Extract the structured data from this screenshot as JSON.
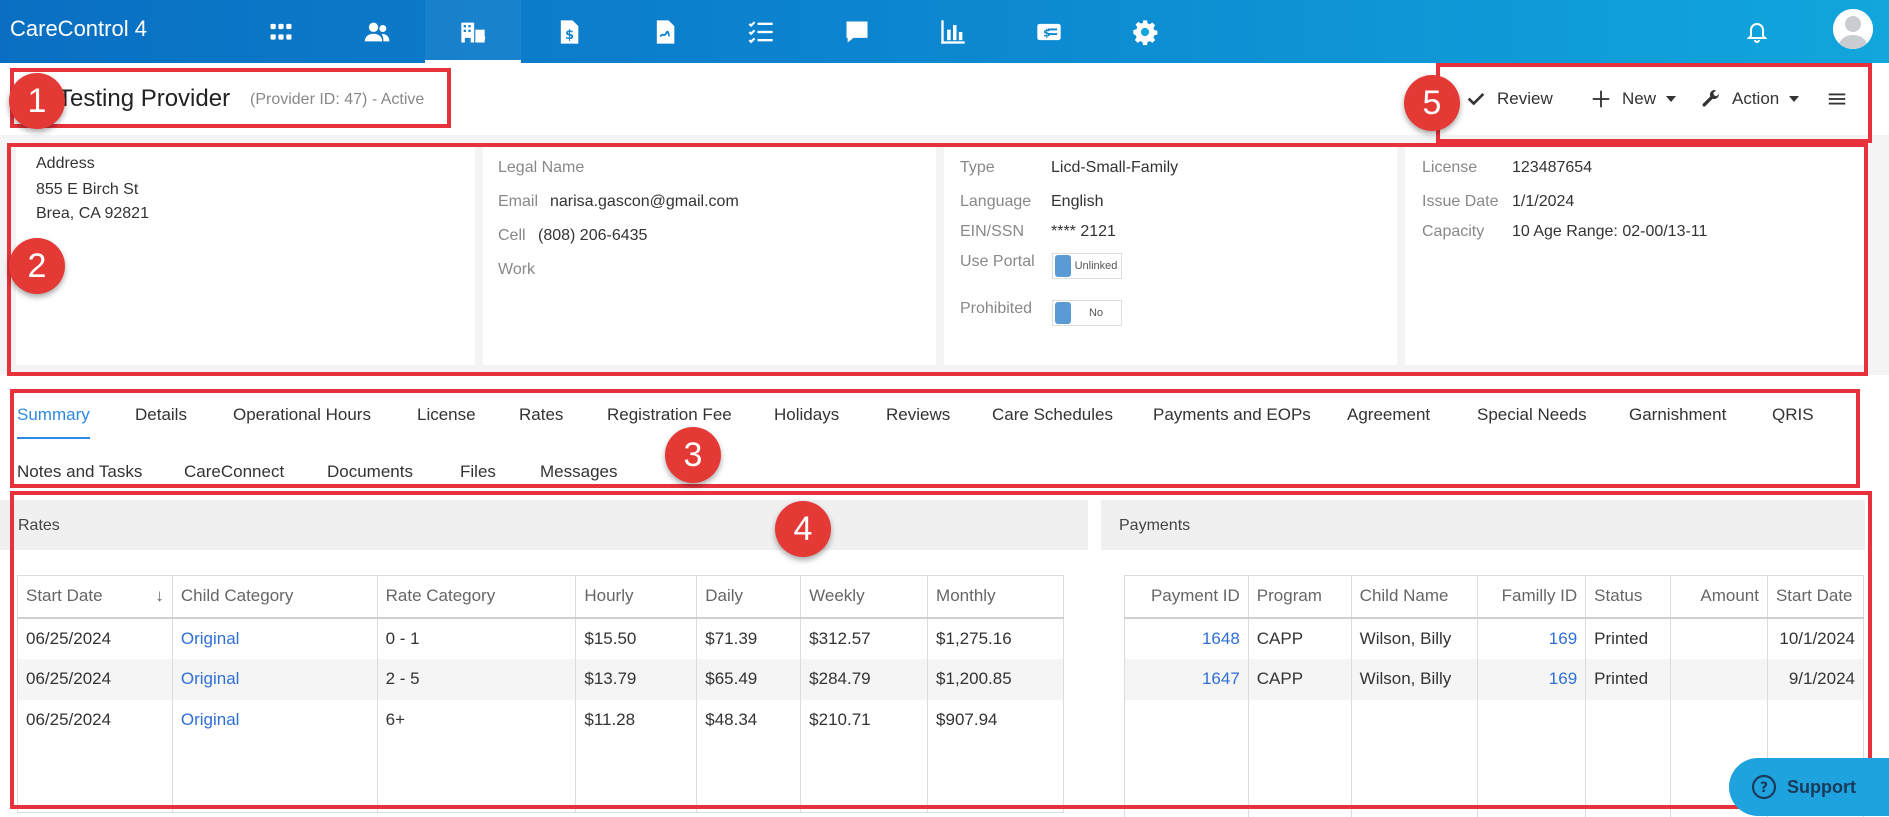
{
  "app": {
    "title": "CareControl 4"
  },
  "nav": {
    "icons": [
      "apps-grid-icon",
      "people-icon",
      "providers-building-icon",
      "billing-dollar-icon",
      "report-file-icon",
      "checklist-icon",
      "chat-bubble-icon",
      "bar-chart-icon",
      "payment-card-icon",
      "gear-icon"
    ],
    "active": "providers-building-icon"
  },
  "header": {
    "provider_name": "Testing Provider",
    "provider_meta": "(Provider ID: 47) - Active",
    "toolbar": {
      "review": "Review",
      "new": "New",
      "action": "Action"
    }
  },
  "info": {
    "address": {
      "label": "Address",
      "line1": "855 E Birch St",
      "line2": "Brea, CA 92821"
    },
    "contact": {
      "legal_name_label": "Legal Name",
      "email_label": "Email",
      "email": "narisa.gascon@gmail.com",
      "cell_label": "Cell",
      "cell": "(808) 206-6435",
      "work_label": "Work"
    },
    "details": {
      "type_label": "Type",
      "type": "Licd-Small-Family",
      "language_label": "Language",
      "language": "English",
      "ein_label": "EIN/SSN",
      "ein": "**** 2121",
      "portal_label": "Use Portal",
      "portal": "Unlinked",
      "prohibited_label": "Prohibited",
      "prohibited": "No"
    },
    "license": {
      "license_label": "License",
      "license": "123487654",
      "issue_label": "Issue Date",
      "issue": "1/1/2024",
      "capacity_label": "Capacity",
      "capacity": "10 Age Range: 02-00/13-11"
    }
  },
  "tabs": [
    "Summary",
    "Details",
    "Operational Hours",
    "License",
    "Rates",
    "Registration Fee",
    "Holidays",
    "Reviews",
    "Care Schedules",
    "Payments and EOPs",
    "Agreement",
    "Special Needs",
    "Garnishment",
    "QRIS",
    "Notes and Tasks",
    "CareConnect",
    "Documents",
    "Files",
    "Messages"
  ],
  "rates": {
    "title": "Rates",
    "columns": [
      "Start Date",
      "Child Category",
      "Rate Category",
      "Hourly",
      "Daily",
      "Weekly",
      "Monthly"
    ],
    "rows": [
      [
        "06/25/2024",
        "Original",
        "0 - 1",
        "$15.50",
        "$71.39",
        "$312.57",
        "$1,275.16"
      ],
      [
        "06/25/2024",
        "Original",
        "2 - 5",
        "$13.79",
        "$65.49",
        "$284.79",
        "$1,200.85"
      ],
      [
        "06/25/2024",
        "Original",
        "6+",
        "$11.28",
        "$48.34",
        "$210.71",
        "$907.94"
      ]
    ]
  },
  "payments": {
    "title": "Payments",
    "columns": [
      "Payment ID",
      "Program",
      "Child Name",
      "Familly ID",
      "Status",
      "Amount",
      "Start Date"
    ],
    "rows": [
      [
        "1648",
        "CAPP",
        "Wilson, Billy",
        "169",
        "Printed",
        "",
        "10/1/2024"
      ],
      [
        "1647",
        "CAPP",
        "Wilson, Billy",
        "169",
        "Printed",
        "",
        "9/1/2024"
      ]
    ]
  },
  "callouts": [
    "1",
    "2",
    "3",
    "4",
    "5"
  ],
  "support": {
    "label": "Support"
  },
  "colors": {
    "callout": "#e8323b",
    "link": "#2f6fd6",
    "nav": "#0c84cf"
  }
}
